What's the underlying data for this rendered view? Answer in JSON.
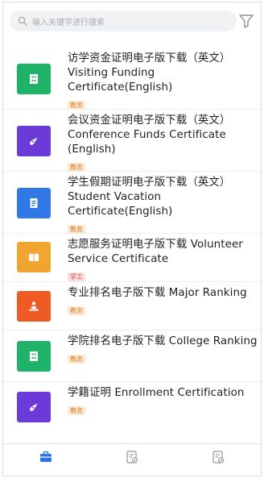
{
  "search": {
    "placeholder": "输入关键字进行搜索"
  },
  "items": [
    {
      "title": "访学资金证明电子版下载（英文）Visiting Funding Certificate(English)",
      "tag": "教务",
      "tag_type": "edu",
      "color": "#1fb36a",
      "icon": "building-icon"
    },
    {
      "title": "会议资金证明电子版下载（英文）Conference Funds Certificate (English)",
      "tag": "教务",
      "tag_type": "edu",
      "color": "#6b3ad8",
      "icon": "compass-icon"
    },
    {
      "title": "学生假期证明电子版下载（英文）Student Vacation Certificate(English)",
      "tag": "教务",
      "tag_type": "edu",
      "color": "#2f78e6",
      "icon": "document-icon"
    },
    {
      "title": "志愿服务证明电子版下载 Volunteer Service Certificate",
      "tag": "学工",
      "tag_type": "stu",
      "color": "#f0a531",
      "icon": "book-icon"
    },
    {
      "title": "专业排名电子版下载 Major Ranking",
      "tag": "教务",
      "tag_type": "edu",
      "color": "#ef5b25",
      "icon": "podium-icon"
    },
    {
      "title": "学院排名电子版下载 College Ranking",
      "tag": "教务",
      "tag_type": "edu",
      "color": "#1fb36a",
      "icon": "building-icon"
    },
    {
      "title": "学籍证明 Enrollment Certification",
      "tag": "教务",
      "tag_type": "edu",
      "color": "#6b3ad8",
      "icon": "compass-icon"
    }
  ],
  "tabs": [
    {
      "label": "",
      "icon": "briefcase-icon",
      "active": true
    },
    {
      "label": "",
      "icon": "form-check-icon",
      "active": false
    },
    {
      "label": "",
      "icon": "form-done-icon",
      "active": false
    }
  ]
}
